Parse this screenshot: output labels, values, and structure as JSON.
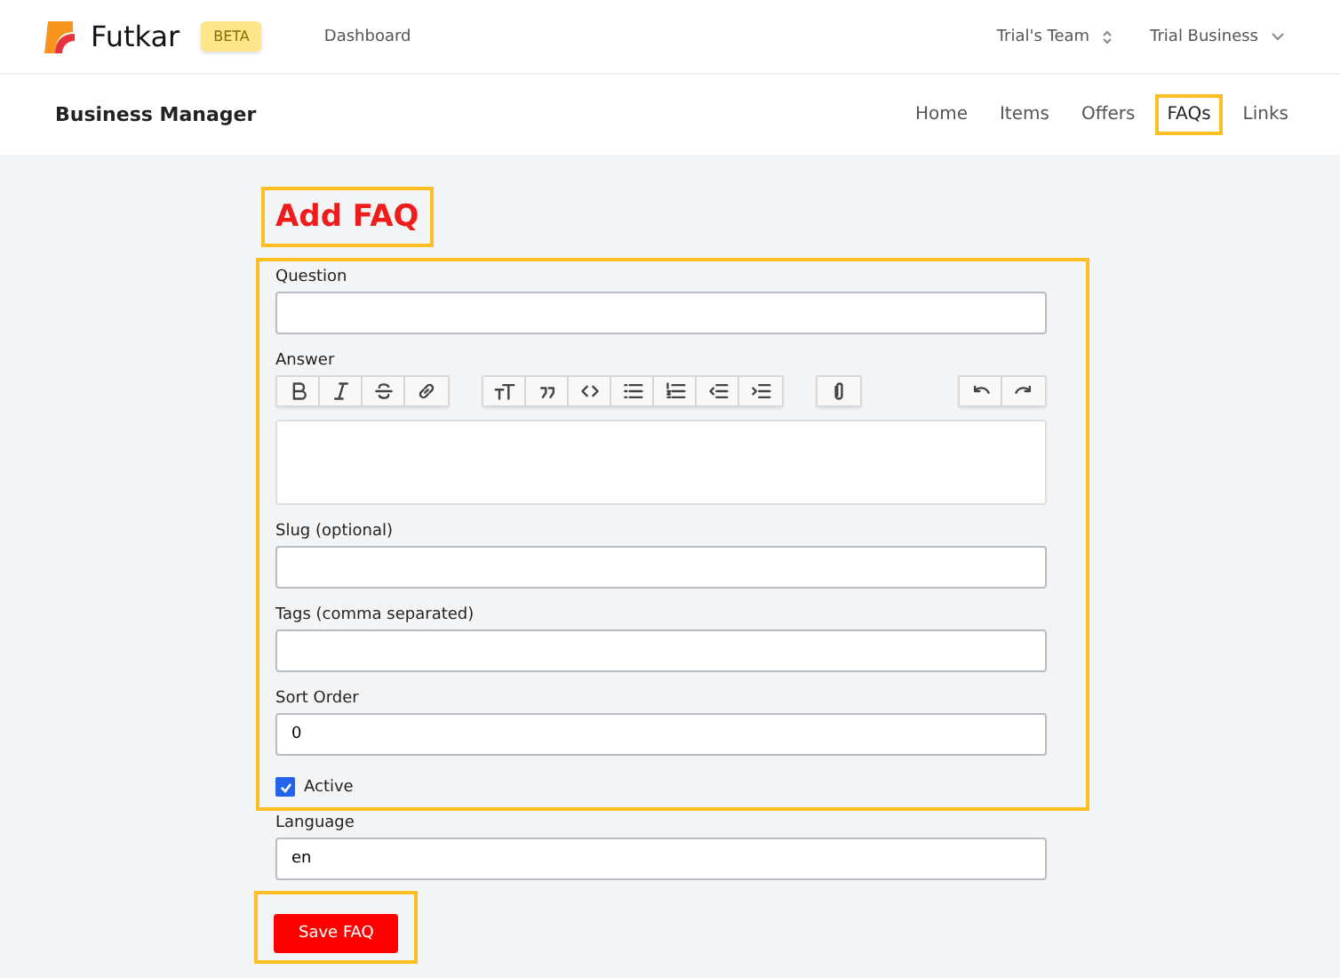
{
  "header": {
    "brand": "Futkar",
    "badge": "BETA",
    "nav": "Dashboard",
    "team": "Trial's Team",
    "business": "Trial Business"
  },
  "subnav": {
    "title": "Business Manager",
    "links": [
      {
        "label": "Home",
        "selected": false,
        "highlighted": false
      },
      {
        "label": "Items",
        "selected": false,
        "highlighted": false
      },
      {
        "label": "Offers",
        "selected": false,
        "highlighted": false
      },
      {
        "label": "FAQs",
        "selected": true,
        "highlighted": true
      },
      {
        "label": "Links",
        "selected": false,
        "highlighted": false
      }
    ]
  },
  "form": {
    "title": "Add FAQ",
    "title_highlighted": true,
    "framed_fields": [
      {
        "kind": "text",
        "label": "Question"
      },
      {
        "kind": "editor",
        "label": "Answer",
        "toolbar_groups": [
          [
            {
              "kind": "bold"
            },
            {
              "kind": "italic"
            },
            {
              "kind": "strike"
            },
            {
              "kind": "link"
            }
          ],
          [
            {
              "kind": "heading"
            },
            {
              "kind": "quote"
            },
            {
              "kind": "code"
            },
            {
              "kind": "bullets"
            },
            {
              "kind": "numbers"
            },
            {
              "kind": "outdent"
            },
            {
              "kind": "indent"
            }
          ],
          [
            {
              "kind": "attach"
            }
          ],
          [
            {
              "kind": "undo"
            },
            {
              "kind": "redo"
            }
          ]
        ]
      },
      {
        "kind": "text",
        "label": "Slug (optional)"
      },
      {
        "kind": "text",
        "label": "Tags (comma separated)"
      },
      {
        "kind": "text",
        "label": "Sort Order",
        "value": "0"
      },
      {
        "kind": "checkbox",
        "label": "Active",
        "checked": true
      }
    ],
    "other_fields": [
      {
        "kind": "text",
        "label": "Language",
        "value": "en"
      }
    ],
    "submit": {
      "label": "Save FAQ",
      "highlighted": true
    }
  }
}
